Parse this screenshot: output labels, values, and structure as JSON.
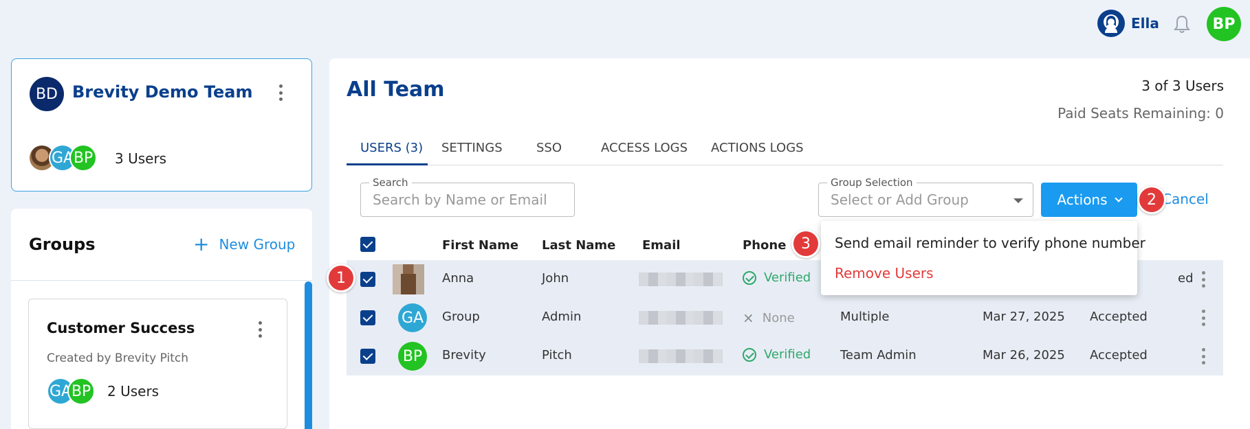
{
  "topbar": {
    "user_name": "Ella",
    "avatar_initials": "BP"
  },
  "team_card": {
    "initials": "BD",
    "name": "Brevity Demo Team",
    "member_avatars": [
      "photo",
      "GA",
      "BP"
    ],
    "users_label": "3 Users"
  },
  "groups": {
    "title": "Groups",
    "new_group_label": "New Group",
    "items": [
      {
        "name": "Customer Success",
        "created_by": "Created by Brevity Pitch",
        "member_avatars": [
          "GA",
          "BP"
        ],
        "users_label": "2 Users"
      }
    ]
  },
  "main": {
    "title": "All Team",
    "user_count": "3 of 3 Users",
    "seats_remaining": "Paid Seats Remaining: 0",
    "tabs": [
      "USERS (3)",
      "SETTINGS",
      "SSO",
      "ACCESS LOGS",
      "ACTIONS LOGS"
    ],
    "active_tab": "USERS (3)",
    "search": {
      "label": "Search",
      "placeholder": "Search by Name or Email"
    },
    "group_selection": {
      "label": "Group Selection",
      "placeholder": "Select or Add Group"
    },
    "actions_label": "Actions",
    "cancel_label": "Cancel"
  },
  "table": {
    "headers": {
      "first_name": "First Name",
      "last_name": "Last Name",
      "email": "Email",
      "phone": "Phone"
    },
    "rows": [
      {
        "avatar": "photo",
        "first": "Anna",
        "last": "John",
        "phone": "Verified",
        "role": "",
        "date": "",
        "status": "ed",
        "checked": true
      },
      {
        "avatar": "GA",
        "first": "Group",
        "last": "Admin",
        "phone": "None",
        "role": "Multiple",
        "date": "Mar 27, 2025",
        "status": "Accepted",
        "checked": true
      },
      {
        "avatar": "BP",
        "first": "Brevity",
        "last": "Pitch",
        "phone": "Verified",
        "role": "Team Admin",
        "date": "Mar 26, 2025",
        "status": "Accepted",
        "checked": true
      }
    ]
  },
  "actions_menu": {
    "items": [
      "Send email reminder to verify phone number",
      "Remove Users"
    ]
  },
  "step_badges": [
    "1",
    "2",
    "3"
  ],
  "colors": {
    "brand_navy": "#0a3f8c",
    "accent_blue": "#1a9bf0",
    "verified_green": "#2ea86a",
    "danger_red": "#e23a3a",
    "bp_green": "#22c322",
    "ga_blue": "#2fa7d4"
  }
}
